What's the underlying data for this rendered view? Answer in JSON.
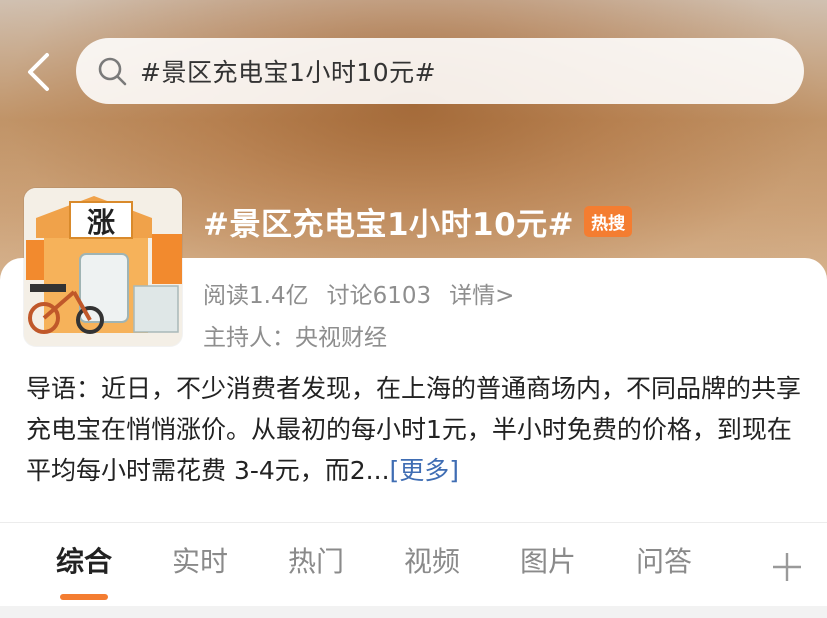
{
  "header": {
    "search_query": "#景区充电宝1小时10元#"
  },
  "topic": {
    "title": "#景区充电宝1小时10元#",
    "badge": "热搜",
    "thumbnail_text": "涨",
    "reads": "阅读1.4亿",
    "discussions": "讨论6103",
    "details_link": "详情>",
    "host": "主持人：央视财经",
    "intro": "导语：近日，不少消费者发现，在上海的普通商场内，不同品牌的共享充电宝在悄悄涨价。从最初的每小时1元，半小时免费的价格，到现在平均每小时需花费 3-4元，而2...",
    "more_link": "[更多]"
  },
  "tabs": [
    {
      "label": "综合",
      "active": true
    },
    {
      "label": "实时",
      "active": false
    },
    {
      "label": "热门",
      "active": false
    },
    {
      "label": "视频",
      "active": false
    },
    {
      "label": "图片",
      "active": false
    },
    {
      "label": "问答",
      "active": false
    }
  ],
  "colors": {
    "accent": "#f47d31",
    "link": "#3f6db3",
    "muted_text": "#8e8e8e"
  },
  "icons": [
    "back-arrow-icon",
    "search-icon",
    "plus-icon"
  ]
}
